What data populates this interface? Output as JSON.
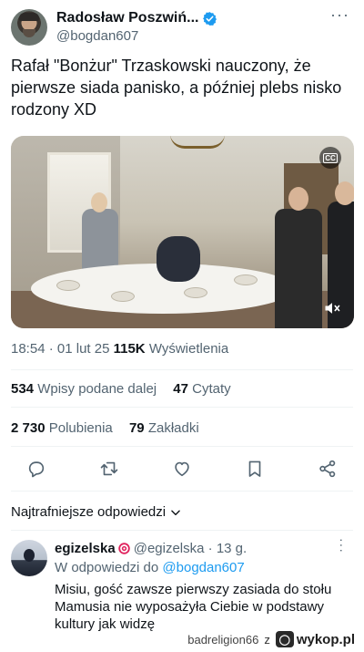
{
  "tweet": {
    "author": {
      "display_name": "Radosław Poszwiń...",
      "handle": "@bogdan607",
      "verified": true
    },
    "text": "Rafał \"Bonżur\" Trzaskowski nauczony, że pierwsze siada panisko, a później plebs nisko rodzony XD",
    "media": {
      "cc_label": "CC"
    },
    "meta": {
      "time": "18:54",
      "separator": "·",
      "date": "01 lut 25",
      "views_count": "115K",
      "views_label": "Wyświetlenia"
    },
    "stats": {
      "reposts_count": "534",
      "reposts_label": "Wpisy podane dalej",
      "quotes_count": "47",
      "quotes_label": "Cytaty",
      "likes_count": "2 730",
      "likes_label": "Polubienia",
      "bookmarks_count": "79",
      "bookmarks_label": "Zakładki"
    },
    "actions": [
      "reply-icon",
      "retweet-icon",
      "like-icon",
      "bookmark-icon",
      "share-icon"
    ]
  },
  "replies": {
    "sort_label": "Najtrafniejsze odpowiedzi",
    "items": [
      {
        "display_name": "egizelska",
        "handle": "@egizelska",
        "separator": "·",
        "age": "13 g.",
        "reply_to_prefix": "W odpowiedzi do",
        "reply_to_handle": "@bogdan607",
        "text": "Misiu, gość zawsze pierwszy zasiada do stołu Mamusia nie wyposażyła Ciebie w podstawy kultury jak widzę"
      }
    ]
  },
  "watermark": {
    "user": "badreligion66",
    "z": "z",
    "site": "wykop.pl"
  },
  "colors": {
    "accent": "#1d9bf0",
    "secondary_text": "#536471",
    "primary_text": "#0f1419"
  }
}
